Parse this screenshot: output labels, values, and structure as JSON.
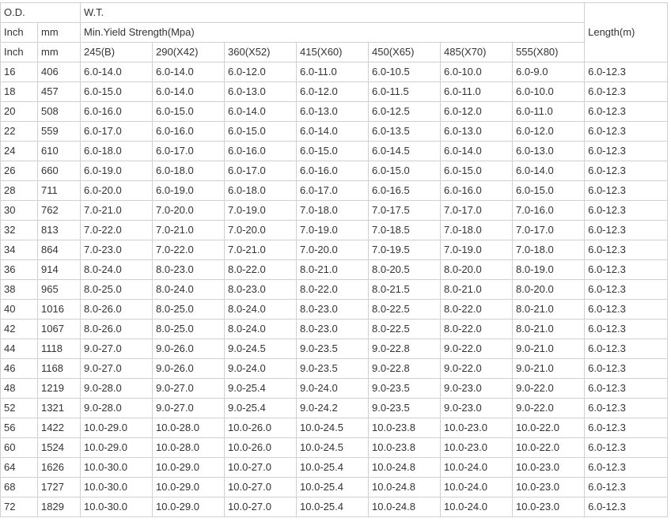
{
  "table": {
    "header": {
      "od_label": "O.D.",
      "wt_label": "W.T.",
      "inch_label": "Inch",
      "mm_label": "mm",
      "yield_label": "Min.Yield Strength(Mpa)",
      "length_label": "Length(m)",
      "inch_label_2": "Inch",
      "mm_label_2": "mm",
      "grades": [
        "245(B)",
        "290(X42)",
        "360(X52)",
        "415(X60)",
        "450(X65)",
        "485(X70)",
        "555(X80)"
      ]
    },
    "rows": [
      [
        "16",
        "406",
        "6.0-14.0",
        "6.0-14.0",
        "6.0-12.0",
        "6.0-11.0",
        "6.0-10.5",
        "6.0-10.0",
        "6.0-9.0",
        "6.0-12.3"
      ],
      [
        "18",
        "457",
        "6.0-15.0",
        "6.0-14.0",
        "6.0-13.0",
        "6.0-12.0",
        "6.0-11.5",
        "6.0-11.0",
        "6.0-10.0",
        "6.0-12.3"
      ],
      [
        "20",
        "508",
        "6.0-16.0",
        "6.0-15.0",
        "6.0-14.0",
        "6.0-13.0",
        "6.0-12.5",
        "6.0-12.0",
        "6.0-11.0",
        "6.0-12.3"
      ],
      [
        "22",
        "559",
        "6.0-17.0",
        "6.0-16.0",
        "6.0-15.0",
        "6.0-14.0",
        "6.0-13.5",
        "6.0-13.0",
        "6.0-12.0",
        "6.0-12.3"
      ],
      [
        "24",
        "610",
        "6.0-18.0",
        "6.0-17.0",
        "6.0-16.0",
        "6.0-15.0",
        "6.0-14.5",
        "6.0-14.0",
        "6.0-13.0",
        "6.0-12.3"
      ],
      [
        "26",
        "660",
        "6.0-19.0",
        "6.0-18.0",
        "6.0-17.0",
        "6.0-16.0",
        "6.0-15.0",
        "6.0-15.0",
        "6.0-14.0",
        "6.0-12.3"
      ],
      [
        "28",
        "711",
        "6.0-20.0",
        "6.0-19.0",
        "6.0-18.0",
        "6.0-17.0",
        "6.0-16.5",
        "6.0-16.0",
        "6.0-15.0",
        "6.0-12.3"
      ],
      [
        "30",
        "762",
        "7.0-21.0",
        "7.0-20.0",
        "7.0-19.0",
        "7.0-18.0",
        "7.0-17.5",
        "7.0-17.0",
        "7.0-16.0",
        "6.0-12.3"
      ],
      [
        "32",
        "813",
        "7.0-22.0",
        "7.0-21.0",
        "7.0-20.0",
        "7.0-19.0",
        "7.0-18.5",
        "7.0-18.0",
        "7.0-17.0",
        "6.0-12.3"
      ],
      [
        "34",
        "864",
        "7.0-23.0",
        "7.0-22.0",
        "7.0-21.0",
        "7.0-20.0",
        "7.0-19.5",
        "7.0-19.0",
        "7.0-18.0",
        "6.0-12.3"
      ],
      [
        "36",
        "914",
        "8.0-24.0",
        "8.0-23.0",
        "8.0-22.0",
        "8.0-21.0",
        "8.0-20.5",
        "8.0-20.0",
        "8.0-19.0",
        "6.0-12.3"
      ],
      [
        "38",
        "965",
        "8.0-25.0",
        "8.0-24.0",
        "8.0-23.0",
        "8.0-22.0",
        "8.0-21.5",
        "8.0-21.0",
        "8.0-20.0",
        "6.0-12.3"
      ],
      [
        "40",
        "1016",
        "8.0-26.0",
        "8.0-25.0",
        "8.0-24.0",
        "8.0-23.0",
        "8.0-22.5",
        "8.0-22.0",
        "8.0-21.0",
        "6.0-12.3"
      ],
      [
        "42",
        "1067",
        "8.0-26.0",
        "8.0-25.0",
        "8.0-24.0",
        "8.0-23.0",
        "8.0-22.5",
        "8.0-22.0",
        "8.0-21.0",
        "6.0-12.3"
      ],
      [
        "44",
        "1118",
        "9.0-27.0",
        "9.0-26.0",
        "9.0-24.5",
        "9.0-23.5",
        "9.0-22.8",
        "9.0-22.0",
        "9.0-21.0",
        "6.0-12.3"
      ],
      [
        "46",
        "1168",
        "9.0-27.0",
        "9.0-26.0",
        "9.0-24.0",
        "9.0-23.5",
        "9.0-22.8",
        "9.0-22.0",
        "9.0-21.0",
        "6.0-12.3"
      ],
      [
        "48",
        "1219",
        "9.0-28.0",
        "9.0-27.0",
        "9.0-25.4",
        "9.0-24.0",
        "9.0-23.5",
        "9.0-23.0",
        "9.0-22.0",
        "6.0-12.3"
      ],
      [
        "52",
        "1321",
        "9.0-28.0",
        "9.0-27.0",
        "9.0-25.4",
        "9.0-24.2",
        "9.0-23.5",
        "9.0-23.0",
        "9.0-22.0",
        "6.0-12.3"
      ],
      [
        "56",
        "1422",
        "10.0-29.0",
        "10.0-28.0",
        "10.0-26.0",
        "10.0-24.5",
        "10.0-23.8",
        "10.0-23.0",
        "10.0-22.0",
        "6.0-12.3"
      ],
      [
        "60",
        "1524",
        "10.0-29.0",
        "10.0-28.0",
        "10.0-26.0",
        "10.0-24.5",
        "10.0-23.8",
        "10.0-23.0",
        "10.0-22.0",
        "6.0-12.3"
      ],
      [
        "64",
        "1626",
        "10.0-30.0",
        "10.0-29.0",
        "10.0-27.0",
        "10.0-25.4",
        "10.0-24.8",
        "10.0-24.0",
        "10.0-23.0",
        "6.0-12.3"
      ],
      [
        "68",
        "1727",
        "10.0-30.0",
        "10.0-29.0",
        "10.0-27.0",
        "10.0-25.4",
        "10.0-24.8",
        "10.0-24.0",
        "10.0-23.0",
        "6.0-12.3"
      ],
      [
        "72",
        "1829",
        "10.0-30.0",
        "10.0-29.0",
        "10.0-27.0",
        "10.0-25.4",
        "10.0-24.8",
        "10.0-24.0",
        "10.0-23.0",
        "6.0-12.3"
      ]
    ]
  }
}
